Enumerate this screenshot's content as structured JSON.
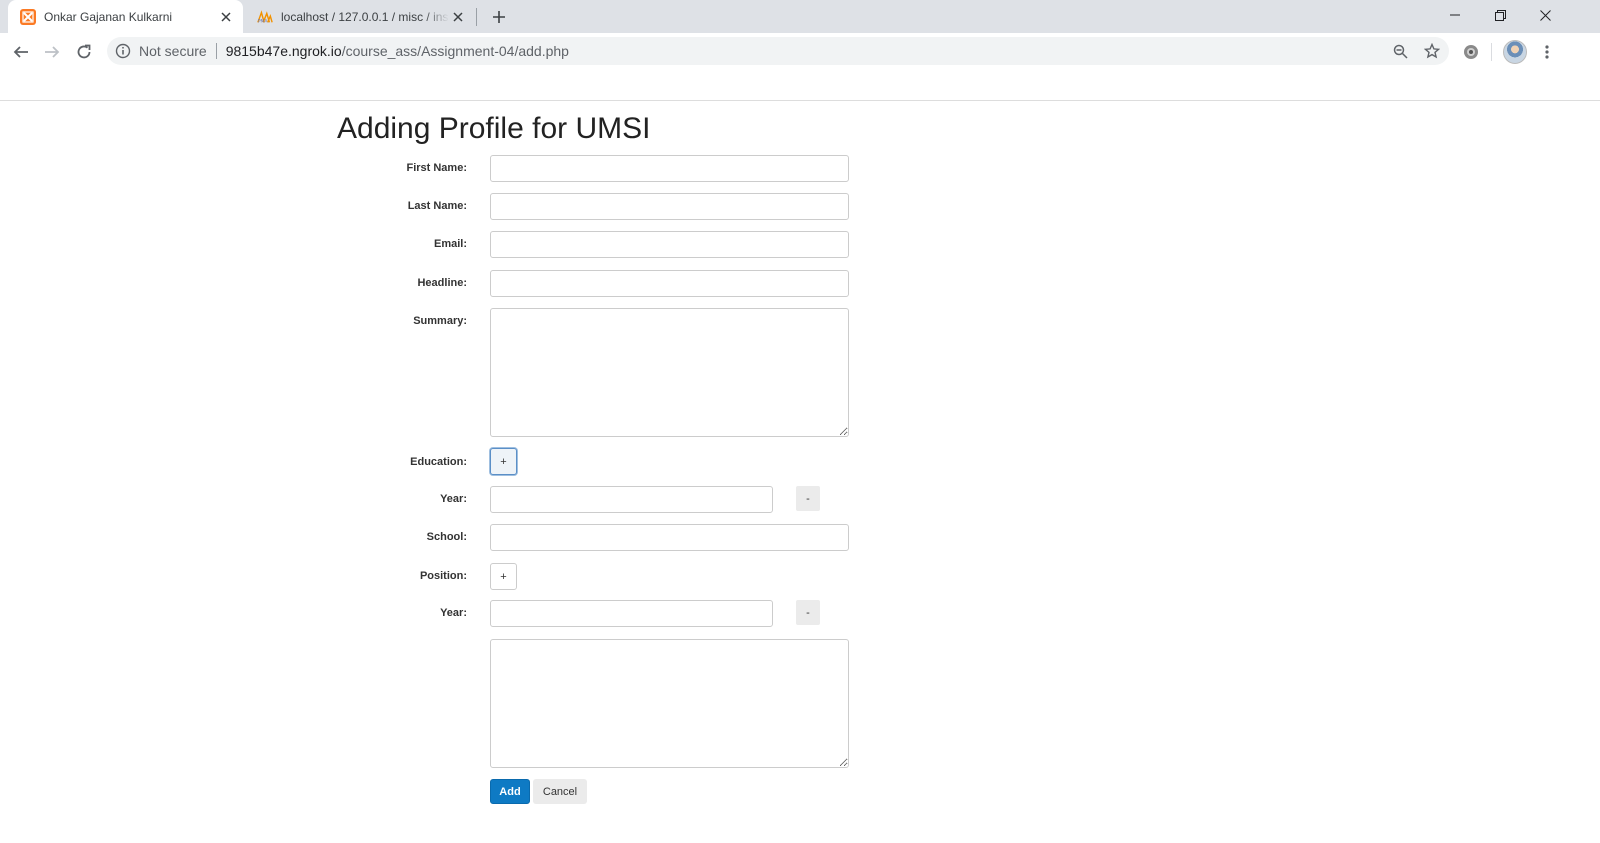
{
  "browser": {
    "tabs": [
      {
        "title": "Onkar Gajanan Kulkarni",
        "favicon": "xampp-icon",
        "active": true
      },
      {
        "title": "localhost / 127.0.0.1 / misc / insti",
        "favicon": "phpmyadmin-icon",
        "active": false
      }
    ],
    "security_label": "Not secure",
    "url_host": "9815b47e.ngrok.io",
    "url_path": "/course_ass/Assignment-04/add.php"
  },
  "page": {
    "title": "Adding Profile for UMSI",
    "labels": {
      "first_name": "First Name:",
      "last_name": "Last Name:",
      "email": "Email:",
      "headline": "Headline:",
      "summary": "Summary:",
      "education": "Education:",
      "edu_year": "Year:",
      "school": "School:",
      "position": "Position:",
      "pos_year": "Year:"
    },
    "values": {
      "first_name": "",
      "last_name": "",
      "email": "",
      "headline": "",
      "summary": "",
      "edu_year": "",
      "school": "",
      "pos_year": "",
      "pos_desc": ""
    },
    "buttons": {
      "add_education": "+",
      "remove_education": "-",
      "add_position": "+",
      "remove_position": "-",
      "add": "Add",
      "cancel": "Cancel"
    }
  },
  "colors": {
    "primary_button": "#0e7ac4",
    "tabstrip": "#dee1e6",
    "omnibox": "#f1f3f4"
  }
}
